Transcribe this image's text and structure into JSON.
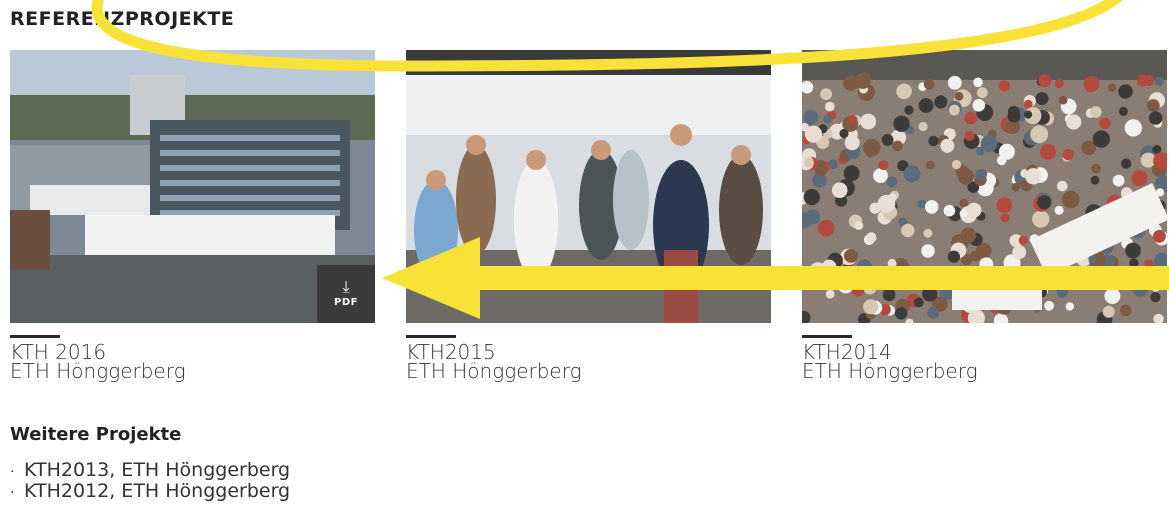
{
  "section_title": "REFERENZPROJEKTE",
  "projects": [
    {
      "name": "KTH 2016",
      "location": "ETH Hönggerberg",
      "pdf_label": "PDF",
      "download_glyph": "⤓"
    },
    {
      "name": "KTH2015",
      "location": "ETH Hönggerberg"
    },
    {
      "name": "KTH2014",
      "location": "ETH Hönggerberg"
    }
  ],
  "more": {
    "title": "Weitere Projekte",
    "items": [
      "KTH2013, ETH Hönggerberg",
      "KTH2012, ETH Hönggerberg"
    ],
    "bullet": "·"
  },
  "colors": {
    "highlight": "#f9e238",
    "text": "#2b2b2b",
    "badge": "#373737"
  },
  "icons": [
    "download-icon",
    "annotation-arrow",
    "annotation-circle"
  ]
}
